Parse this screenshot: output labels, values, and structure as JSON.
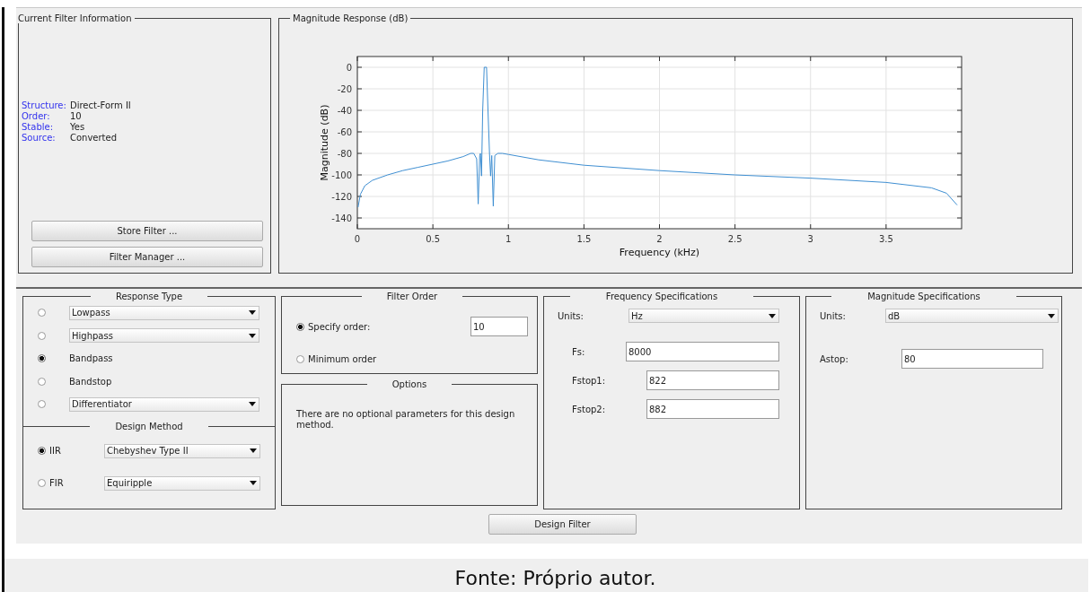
{
  "current_filter_information": {
    "title": "Current Filter Information",
    "fields": [
      {
        "label": "Structure:",
        "value": "Direct-Form II"
      },
      {
        "label": "Order:",
        "value": "10"
      },
      {
        "label": "Stable:",
        "value": "Yes"
      },
      {
        "label": "Source:",
        "value": "Converted"
      }
    ],
    "buttons": [
      "Store Filter ...",
      "Filter Manager ..."
    ]
  },
  "magnitude_response": {
    "title": "Magnitude Response (dB)",
    "chart_data": {
      "type": "line",
      "xlabel": "Frequency (kHz)",
      "ylabel": "Magnitude (dB)",
      "grid": true,
      "xlim": [
        0,
        4
      ],
      "ylim": [
        -150,
        10
      ],
      "xticks": [
        0,
        0.5,
        1,
        1.5,
        2,
        2.5,
        3,
        3.5
      ],
      "yticks": [
        0,
        -20,
        -40,
        -60,
        -80,
        -100,
        -120,
        -140
      ],
      "x": [
        0.005,
        0.02,
        0.05,
        0.1,
        0.2,
        0.3,
        0.4,
        0.5,
        0.6,
        0.7,
        0.75,
        0.77,
        0.79,
        0.8,
        0.81,
        0.815,
        0.822,
        0.83,
        0.84,
        0.855,
        0.865,
        0.875,
        0.882,
        0.89,
        0.9,
        0.91,
        0.93,
        0.96,
        1,
        1.2,
        1.5,
        2,
        2.5,
        3,
        3.5,
        3.8,
        3.9,
        3.97
      ],
      "series": [
        {
          "color": "#3f8fd2",
          "values": [
            -130,
            -118,
            -110,
            -105,
            -100,
            -96,
            -93,
            -90,
            -87,
            -83,
            -80,
            -80,
            -85,
            -127,
            -82,
            -80,
            -101,
            -40,
            0,
            0,
            -40,
            -80,
            -101,
            -82,
            -129,
            -82,
            -80,
            -80,
            -81,
            -86,
            -91,
            -96,
            -100,
            -103,
            -107,
            -112,
            -117,
            -128
          ]
        }
      ]
    }
  },
  "response_type": {
    "title": "Response Type",
    "options": [
      {
        "kind": "dropdown",
        "value": "Lowpass",
        "selected": false
      },
      {
        "kind": "dropdown",
        "value": "Highpass",
        "selected": false
      },
      {
        "kind": "label",
        "label": "Bandpass",
        "selected": true
      },
      {
        "kind": "label",
        "label": "Bandstop",
        "selected": false
      },
      {
        "kind": "dropdown",
        "value": "Differentiator",
        "selected": false
      }
    ]
  },
  "design_method": {
    "title": "Design Method",
    "options": [
      {
        "label": "IIR",
        "selected": true,
        "dropdown": "Chebyshev Type II"
      },
      {
        "label": "FIR",
        "selected": false,
        "dropdown": "Equiripple"
      }
    ]
  },
  "filter_order": {
    "title": "Filter Order",
    "options": [
      {
        "label": "Specify order:",
        "selected": true,
        "value": "10"
      },
      {
        "label": "Minimum order",
        "selected": false
      }
    ]
  },
  "options": {
    "title": "Options",
    "text": "There are no optional parameters for this design method."
  },
  "frequency_specifications": {
    "title": "Frequency Specifications",
    "units_label": "Units:",
    "units": "Hz",
    "fields": [
      {
        "label": "Fs:",
        "value": "8000"
      },
      {
        "label": "Fstop1:",
        "value": "822"
      },
      {
        "label": "Fstop2:",
        "value": "882"
      }
    ]
  },
  "magnitude_specifications": {
    "title": "Magnitude Specifications",
    "units_label": "Units:",
    "units": "dB",
    "fields": [
      {
        "label": "Astop:",
        "value": "80"
      }
    ]
  },
  "design_button": "Design Filter",
  "caption": "Fonte: Próprio autor."
}
